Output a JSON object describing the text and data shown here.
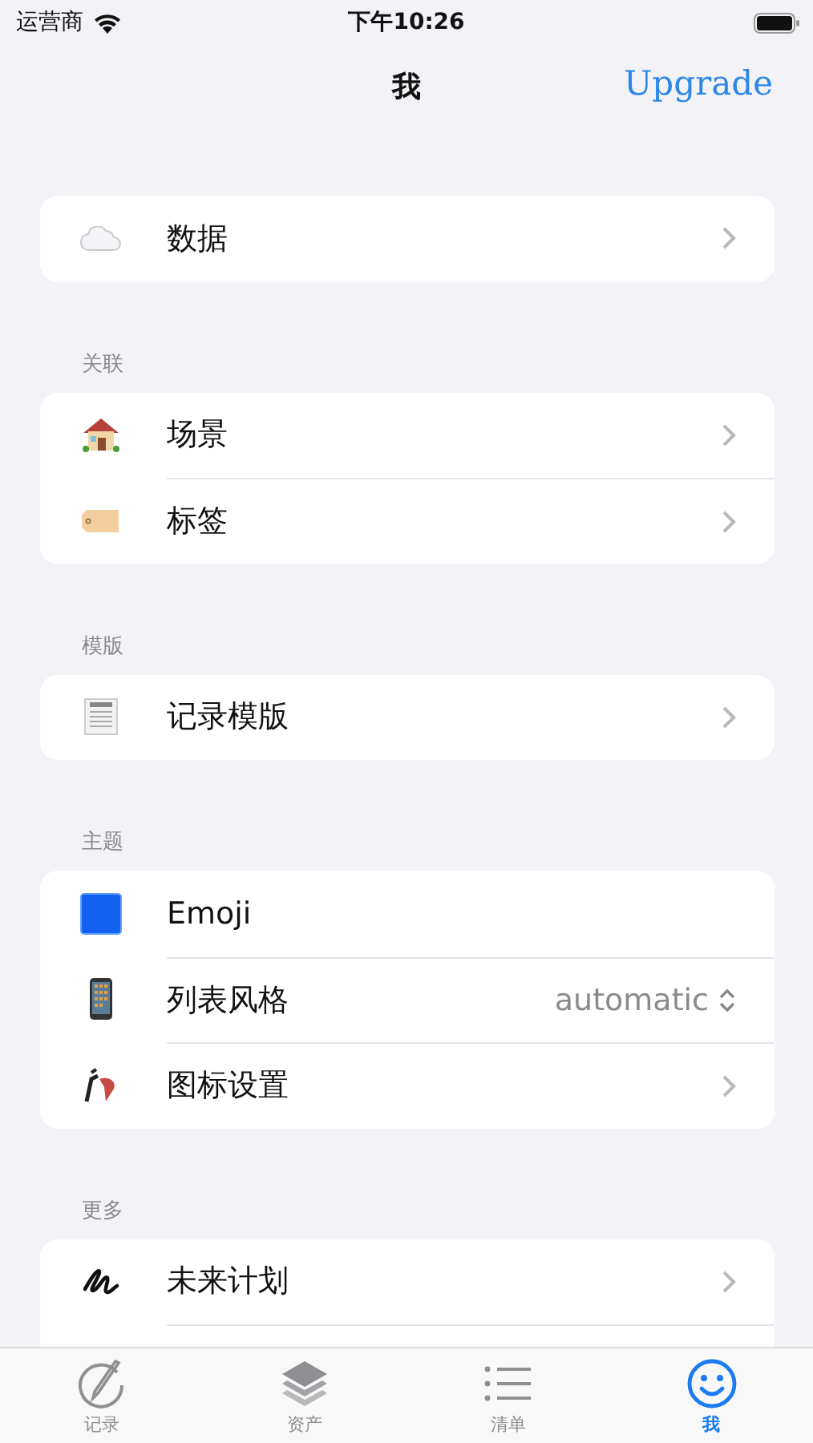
{
  "status_bar": {
    "carrier": "运营商",
    "time": "下午10:26"
  },
  "nav": {
    "title": "我",
    "action": "Upgrade"
  },
  "sections": [
    {
      "items": [
        {
          "kind": "chevron",
          "label": "数据"
        }
      ]
    },
    {
      "header": "关联",
      "items": [
        {
          "kind": "chevron",
          "label": "场景"
        },
        {
          "kind": "chevron",
          "label": "标签"
        }
      ]
    },
    {
      "header": "模版",
      "items": [
        {
          "kind": "chevron",
          "label": "记录模版"
        }
      ]
    },
    {
      "header": "主题",
      "items": [
        {
          "kind": "plain",
          "label": "Emoji"
        },
        {
          "kind": "picker",
          "label": "列表风格",
          "value": "automatic"
        },
        {
          "kind": "chevron",
          "label": "图标设置"
        }
      ]
    },
    {
      "header": "更多",
      "items": [
        {
          "kind": "chevron",
          "label": "未来计划"
        }
      ]
    }
  ],
  "tabs": [
    {
      "label": "记录",
      "selected": false
    },
    {
      "label": "资产",
      "selected": false
    },
    {
      "label": "清单",
      "selected": false
    },
    {
      "label": "我",
      "selected": true
    }
  ]
}
